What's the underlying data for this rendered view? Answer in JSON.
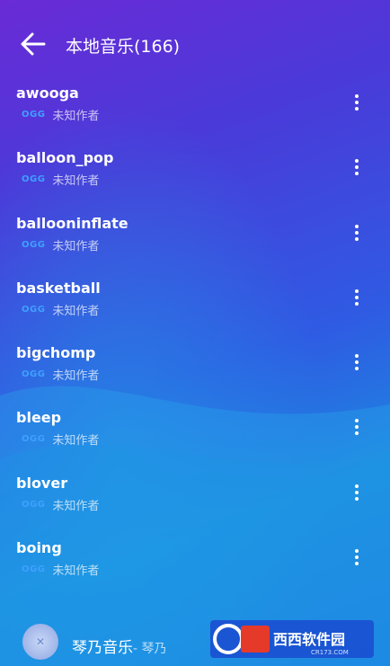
{
  "header": {
    "title": "本地音乐(166)"
  },
  "songs": [
    {
      "name": "awooga",
      "format": "OGG",
      "artist": "未知作者"
    },
    {
      "name": "balloon_pop",
      "format": "OGG",
      "artist": "未知作者"
    },
    {
      "name": "ballooninflate",
      "format": "OGG",
      "artist": "未知作者"
    },
    {
      "name": "basketball",
      "format": "OGG",
      "artist": "未知作者"
    },
    {
      "name": "bigchomp",
      "format": "OGG",
      "artist": "未知作者"
    },
    {
      "name": "bleep",
      "format": "OGG",
      "artist": "未知作者"
    },
    {
      "name": "blover",
      "format": "OGG",
      "artist": "未知作者"
    },
    {
      "name": "boing",
      "format": "OGG",
      "artist": "未知作者"
    }
  ],
  "player": {
    "title": "琴乃音乐",
    "artist": "- 琴乃"
  },
  "watermark": {
    "logo_text": "西西软件园",
    "url_text": "CR173.COM"
  }
}
